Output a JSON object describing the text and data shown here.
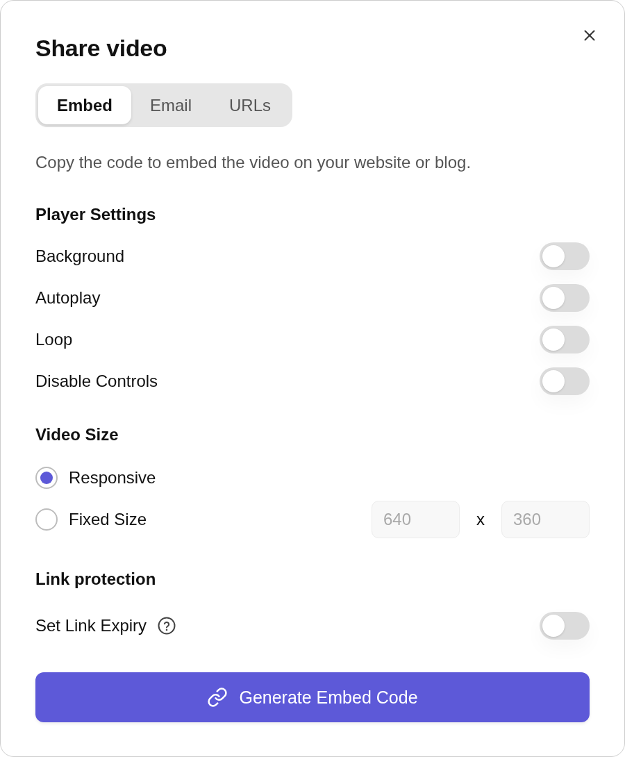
{
  "dialog_title": "Share video",
  "tabs": [
    {
      "label": "Embed",
      "selected": true
    },
    {
      "label": "Email",
      "selected": false
    },
    {
      "label": "URLs",
      "selected": false
    }
  ],
  "description": "Copy the code to embed the video on your website or blog.",
  "player_settings": {
    "heading": "Player Settings",
    "toggles": [
      {
        "label": "Background",
        "on": false
      },
      {
        "label": "Autoplay",
        "on": false
      },
      {
        "label": "Loop",
        "on": false
      },
      {
        "label": "Disable Controls",
        "on": false
      }
    ]
  },
  "video_size": {
    "heading": "Video Size",
    "options": [
      {
        "label": "Responsive",
        "selected": true
      },
      {
        "label": "Fixed Size",
        "selected": false,
        "size": {
          "width": {
            "placeholder": "640",
            "disabled": true
          },
          "separator": "x",
          "height": {
            "placeholder": "360",
            "disabled": true
          }
        }
      }
    ]
  },
  "link_protection": {
    "heading": "Link protection",
    "toggles": [
      {
        "label": "Set Link Expiry",
        "on": false,
        "help": true
      }
    ]
  },
  "primary_button": {
    "label": "Generate Embed Code"
  }
}
